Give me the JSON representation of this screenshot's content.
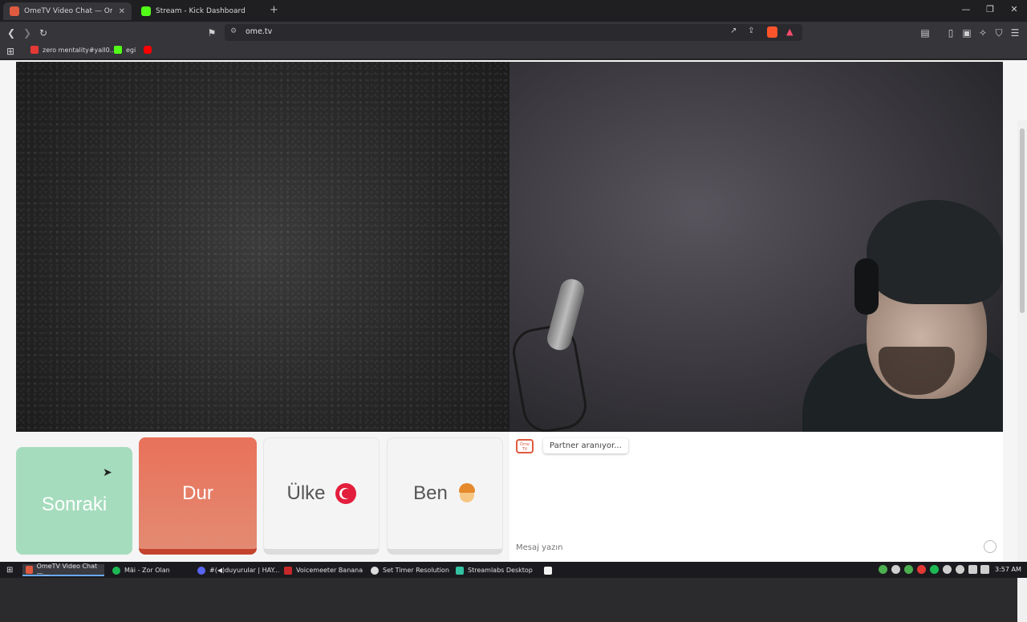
{
  "browser": {
    "tabs": [
      {
        "title": "OmeTV Video Chat — Omeg",
        "favicon_color": "#e05a3f",
        "active": true
      },
      {
        "title": "Stream - Kick Dashboard",
        "favicon_color": "#53fc18",
        "active": false
      }
    ],
    "new_tab": "+",
    "url": "ome.tv",
    "bookmarks": [
      {
        "label": "zero mentality#yall0...",
        "favicon_color": "#e53935"
      },
      {
        "label": "egi",
        "favicon_color": "#53fc18"
      },
      {
        "label": "",
        "favicon_color": "#ff0000"
      }
    ]
  },
  "controls": {
    "next": "Sonraki",
    "stop": "Dur",
    "country": "Ülke",
    "me": "Ben"
  },
  "chat": {
    "logo_text": "Ome TV",
    "status": "Partner aranıyor...",
    "input_placeholder": "Mesaj yazın"
  },
  "taskbar": {
    "items": [
      {
        "label": "OmeTV Video Chat —...",
        "favicon_color": "#e05a3f",
        "active": true
      },
      {
        "label": "Mäi - Zor Olan",
        "favicon_color": "#1db954",
        "active": false
      },
      {
        "label": "#(◀)duyurular | HAY...",
        "favicon_color": "#5865f2",
        "active": false
      },
      {
        "label": "Voicemeeter Banana",
        "favicon_color": "#c62828",
        "active": false
      },
      {
        "label": "Set Timer Resolution",
        "favicon_color": "#dddddd",
        "active": false
      },
      {
        "label": "Streamlabs Desktop",
        "favicon_color": "#31c3a2",
        "active": false
      }
    ],
    "time": "3:57 AM"
  }
}
